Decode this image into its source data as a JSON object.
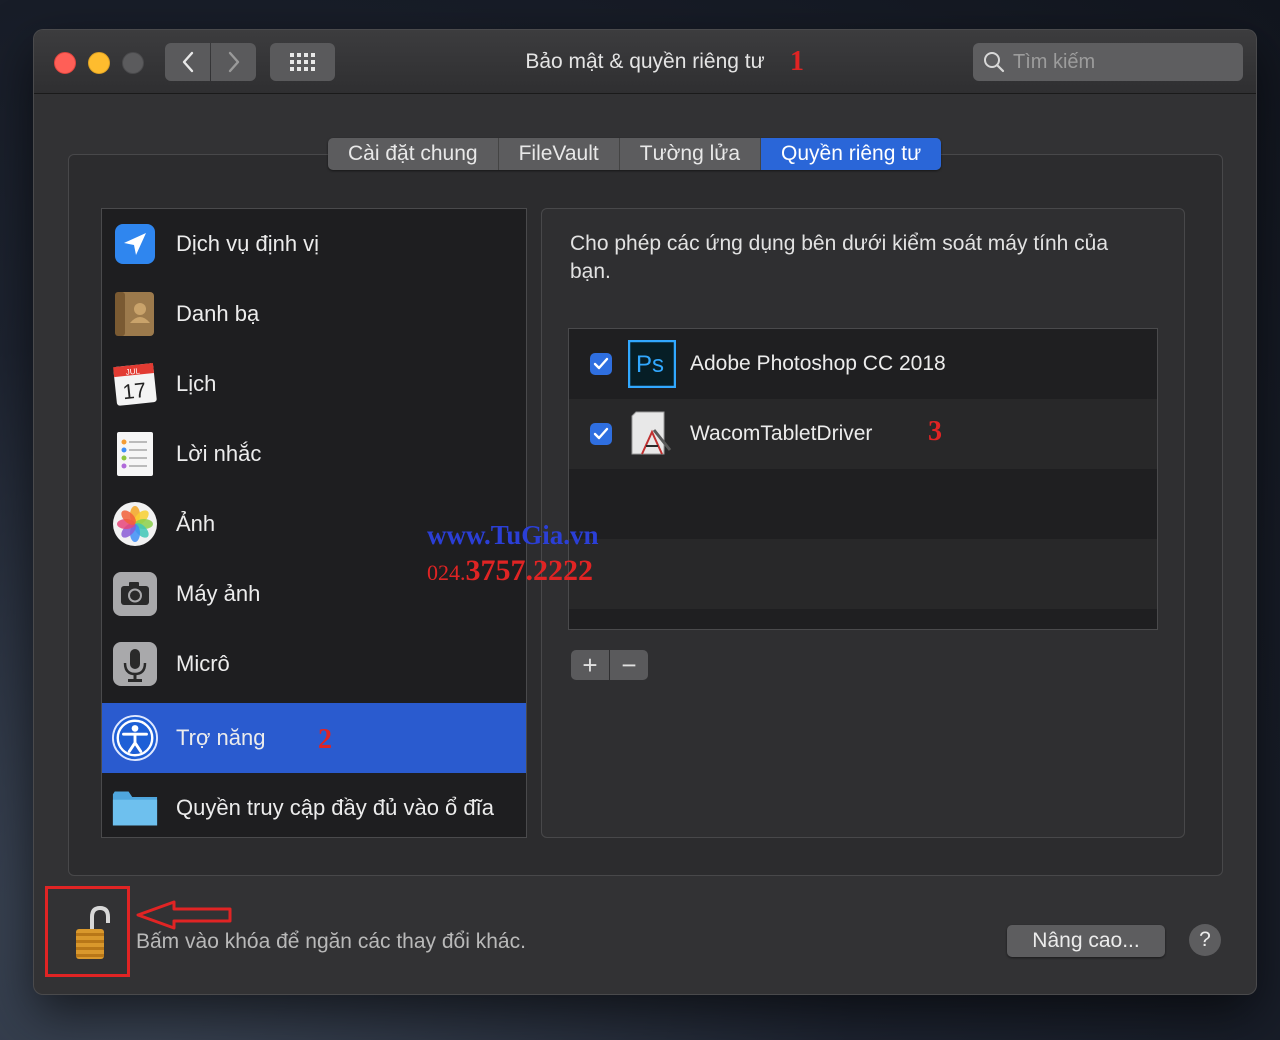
{
  "window": {
    "title": "Bảo mật & quyền riêng tư",
    "search_placeholder": "Tìm kiếm"
  },
  "tabs": [
    {
      "label": "Cài đặt chung"
    },
    {
      "label": "FileVault"
    },
    {
      "label": "Tường lửa"
    },
    {
      "label": "Quyền riêng tư",
      "active": true
    }
  ],
  "sidebar": {
    "items": [
      {
        "label": "Dịch vụ định vị",
        "icon": "location-arrow-icon"
      },
      {
        "label": "Danh bạ",
        "icon": "contacts-book-icon"
      },
      {
        "label": "Lịch",
        "icon": "calendar-icon",
        "icon_month": "JUL",
        "icon_day": "17"
      },
      {
        "label": "Lời nhắc",
        "icon": "reminders-icon"
      },
      {
        "label": "Ảnh",
        "icon": "photos-icon"
      },
      {
        "label": "Máy ảnh",
        "icon": "camera-icon"
      },
      {
        "label": "Micrô",
        "icon": "microphone-icon"
      },
      {
        "label": "Trợ năng",
        "icon": "accessibility-icon",
        "selected": true
      },
      {
        "label": "Quyền truy cập đầy đủ vào ổ đĩa",
        "icon": "folder-icon"
      }
    ]
  },
  "detail": {
    "description": "Cho phép các ứng dụng bên dưới kiểm soát máy tính của bạn.",
    "apps": [
      {
        "name": "Adobe Photoshop CC 2018",
        "checked": true,
        "icon": "photoshop-icon",
        "icon_text": "Ps"
      },
      {
        "name": "WacomTabletDriver",
        "checked": true,
        "icon": "wacom-driver-icon"
      }
    ],
    "add_label": "+",
    "remove_label": "−"
  },
  "footer": {
    "lock_text": "Bấm vào khóa để ngăn các thay đổi khác.",
    "advanced_label": "Nâng cao...",
    "help_label": "?"
  },
  "annotations": {
    "one": "1",
    "two": "2",
    "three": "3"
  },
  "watermark": {
    "site": "www.TuGia.vn",
    "phone_prefix": "024.",
    "phone_number": "3757.2222"
  },
  "colors": {
    "accent": "#2a5bcf",
    "annotation": "#e02424",
    "watermark_blue": "#2b3fd6"
  }
}
